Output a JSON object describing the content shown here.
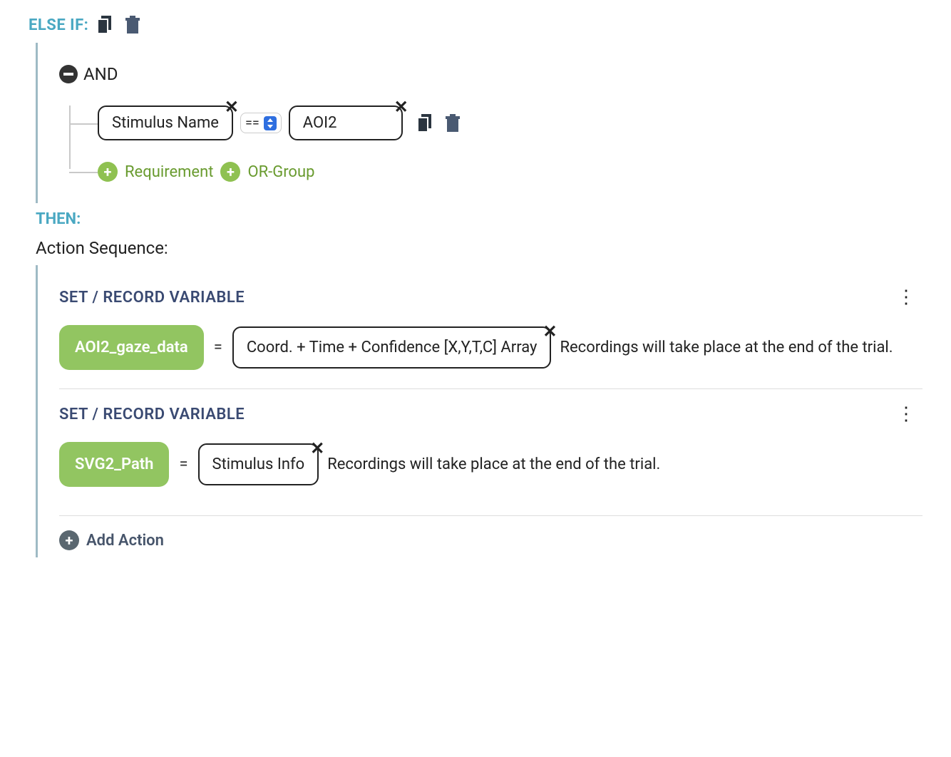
{
  "elseif": {
    "label": "ELSE IF:",
    "and_label": "AND",
    "condition": {
      "lhs": "Stimulus Name",
      "op": "==",
      "rhs": "AOI2"
    },
    "add_requirement": "Requirement",
    "add_orgroup": "OR-Group"
  },
  "then": {
    "label": "THEN:",
    "sequence_label": "Action Sequence:",
    "actions": [
      {
        "title": "SET / RECORD VARIABLE",
        "var_name": "AOI2_gaze_data",
        "value_box": "Coord. + Time + Confidence [X,Y,T,C] Array",
        "note": "Recordings will take place at the end of the trial."
      },
      {
        "title": "SET / RECORD VARIABLE",
        "var_name": "SVG2_Path",
        "value_box": "Stimulus Info",
        "note": "Recordings will take place at the end of the trial."
      }
    ],
    "add_action": "Add Action"
  }
}
